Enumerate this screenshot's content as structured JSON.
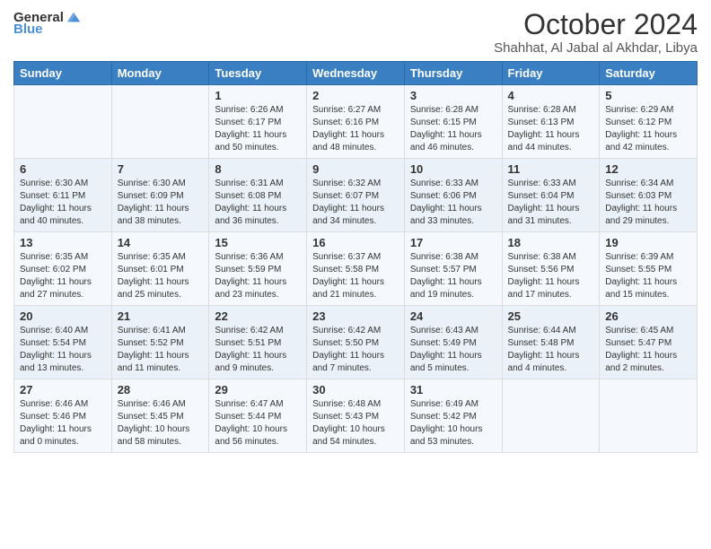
{
  "header": {
    "logo": {
      "general": "General",
      "blue": "Blue"
    },
    "title": "October 2024",
    "location": "Shahhat, Al Jabal al Akhdar, Libya"
  },
  "weekdays": [
    "Sunday",
    "Monday",
    "Tuesday",
    "Wednesday",
    "Thursday",
    "Friday",
    "Saturday"
  ],
  "weeks": [
    [
      null,
      null,
      {
        "day": 1,
        "sunrise": "6:26 AM",
        "sunset": "6:17 PM",
        "daylight": "11 hours and 50 minutes."
      },
      {
        "day": 2,
        "sunrise": "6:27 AM",
        "sunset": "6:16 PM",
        "daylight": "11 hours and 48 minutes."
      },
      {
        "day": 3,
        "sunrise": "6:28 AM",
        "sunset": "6:15 PM",
        "daylight": "11 hours and 46 minutes."
      },
      {
        "day": 4,
        "sunrise": "6:28 AM",
        "sunset": "6:13 PM",
        "daylight": "11 hours and 44 minutes."
      },
      {
        "day": 5,
        "sunrise": "6:29 AM",
        "sunset": "6:12 PM",
        "daylight": "11 hours and 42 minutes."
      }
    ],
    [
      {
        "day": 6,
        "sunrise": "6:30 AM",
        "sunset": "6:11 PM",
        "daylight": "11 hours and 40 minutes."
      },
      {
        "day": 7,
        "sunrise": "6:30 AM",
        "sunset": "6:09 PM",
        "daylight": "11 hours and 38 minutes."
      },
      {
        "day": 8,
        "sunrise": "6:31 AM",
        "sunset": "6:08 PM",
        "daylight": "11 hours and 36 minutes."
      },
      {
        "day": 9,
        "sunrise": "6:32 AM",
        "sunset": "6:07 PM",
        "daylight": "11 hours and 34 minutes."
      },
      {
        "day": 10,
        "sunrise": "6:33 AM",
        "sunset": "6:06 PM",
        "daylight": "11 hours and 33 minutes."
      },
      {
        "day": 11,
        "sunrise": "6:33 AM",
        "sunset": "6:04 PM",
        "daylight": "11 hours and 31 minutes."
      },
      {
        "day": 12,
        "sunrise": "6:34 AM",
        "sunset": "6:03 PM",
        "daylight": "11 hours and 29 minutes."
      }
    ],
    [
      {
        "day": 13,
        "sunrise": "6:35 AM",
        "sunset": "6:02 PM",
        "daylight": "11 hours and 27 minutes."
      },
      {
        "day": 14,
        "sunrise": "6:35 AM",
        "sunset": "6:01 PM",
        "daylight": "11 hours and 25 minutes."
      },
      {
        "day": 15,
        "sunrise": "6:36 AM",
        "sunset": "5:59 PM",
        "daylight": "11 hours and 23 minutes."
      },
      {
        "day": 16,
        "sunrise": "6:37 AM",
        "sunset": "5:58 PM",
        "daylight": "11 hours and 21 minutes."
      },
      {
        "day": 17,
        "sunrise": "6:38 AM",
        "sunset": "5:57 PM",
        "daylight": "11 hours and 19 minutes."
      },
      {
        "day": 18,
        "sunrise": "6:38 AM",
        "sunset": "5:56 PM",
        "daylight": "11 hours and 17 minutes."
      },
      {
        "day": 19,
        "sunrise": "6:39 AM",
        "sunset": "5:55 PM",
        "daylight": "11 hours and 15 minutes."
      }
    ],
    [
      {
        "day": 20,
        "sunrise": "6:40 AM",
        "sunset": "5:54 PM",
        "daylight": "11 hours and 13 minutes."
      },
      {
        "day": 21,
        "sunrise": "6:41 AM",
        "sunset": "5:52 PM",
        "daylight": "11 hours and 11 minutes."
      },
      {
        "day": 22,
        "sunrise": "6:42 AM",
        "sunset": "5:51 PM",
        "daylight": "11 hours and 9 minutes."
      },
      {
        "day": 23,
        "sunrise": "6:42 AM",
        "sunset": "5:50 PM",
        "daylight": "11 hours and 7 minutes."
      },
      {
        "day": 24,
        "sunrise": "6:43 AM",
        "sunset": "5:49 PM",
        "daylight": "11 hours and 5 minutes."
      },
      {
        "day": 25,
        "sunrise": "6:44 AM",
        "sunset": "5:48 PM",
        "daylight": "11 hours and 4 minutes."
      },
      {
        "day": 26,
        "sunrise": "6:45 AM",
        "sunset": "5:47 PM",
        "daylight": "11 hours and 2 minutes."
      }
    ],
    [
      {
        "day": 27,
        "sunrise": "6:46 AM",
        "sunset": "5:46 PM",
        "daylight": "11 hours and 0 minutes."
      },
      {
        "day": 28,
        "sunrise": "6:46 AM",
        "sunset": "5:45 PM",
        "daylight": "10 hours and 58 minutes."
      },
      {
        "day": 29,
        "sunrise": "6:47 AM",
        "sunset": "5:44 PM",
        "daylight": "10 hours and 56 minutes."
      },
      {
        "day": 30,
        "sunrise": "6:48 AM",
        "sunset": "5:43 PM",
        "daylight": "10 hours and 54 minutes."
      },
      {
        "day": 31,
        "sunrise": "6:49 AM",
        "sunset": "5:42 PM",
        "daylight": "10 hours and 53 minutes."
      },
      null,
      null
    ]
  ]
}
